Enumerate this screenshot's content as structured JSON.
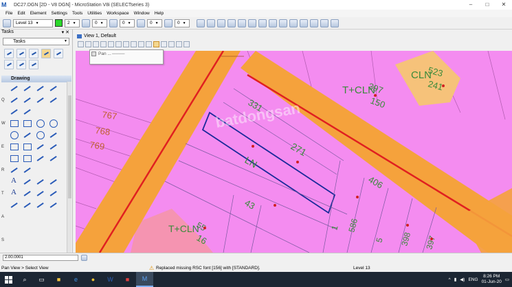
{
  "window": {
    "title": "DC27.DGN [2D - V8 DGN] - MicroStation V8i (SELECTseries 3)",
    "controls": [
      "–",
      "□",
      "✕"
    ]
  },
  "menu": [
    "File",
    "Edit",
    "Element",
    "Settings",
    "Tools",
    "Utilities",
    "Workspace",
    "Window",
    "Help"
  ],
  "toolbar": {
    "level": "Level 13",
    "color_value": "2",
    "color_swatch": "#2bd82b",
    "weight": "0",
    "style": "0",
    "transparency": "0",
    "priority": "0"
  },
  "tasks": {
    "header": "Tasks",
    "dropdown": "Tasks",
    "drawing_label": "Drawing",
    "keys": [
      "Q",
      "W",
      "E",
      "R",
      "T",
      "A",
      "S"
    ]
  },
  "view": {
    "title": "View 1, Default"
  },
  "pan_dialog": {
    "title": "Pan ..."
  },
  "map_labels": {
    "l767": "767",
    "l768": "768",
    "l769": "769",
    "tcln_top": "T+CLN",
    "n397": "397",
    "n150": "150",
    "cln_box": "CLN",
    "n523": "523",
    "n241": "241",
    "n331": "331",
    "n271": "271",
    "ln": "LN",
    "n406": "406",
    "n43": "43",
    "tcln_bottom": "T+CLN",
    "n16": "16",
    "n55": "55",
    "watermark": "batdongsan"
  },
  "statusbar": {
    "key_in": "2.00.0001",
    "prompt": "Pan View > Select View",
    "message": "Replaced missing RSC font [156] with [STANDARD].",
    "level": "Level 13"
  },
  "taskbar": {
    "lang": "ENG",
    "time": "8:26 PM",
    "date": "01-Jun-20"
  }
}
